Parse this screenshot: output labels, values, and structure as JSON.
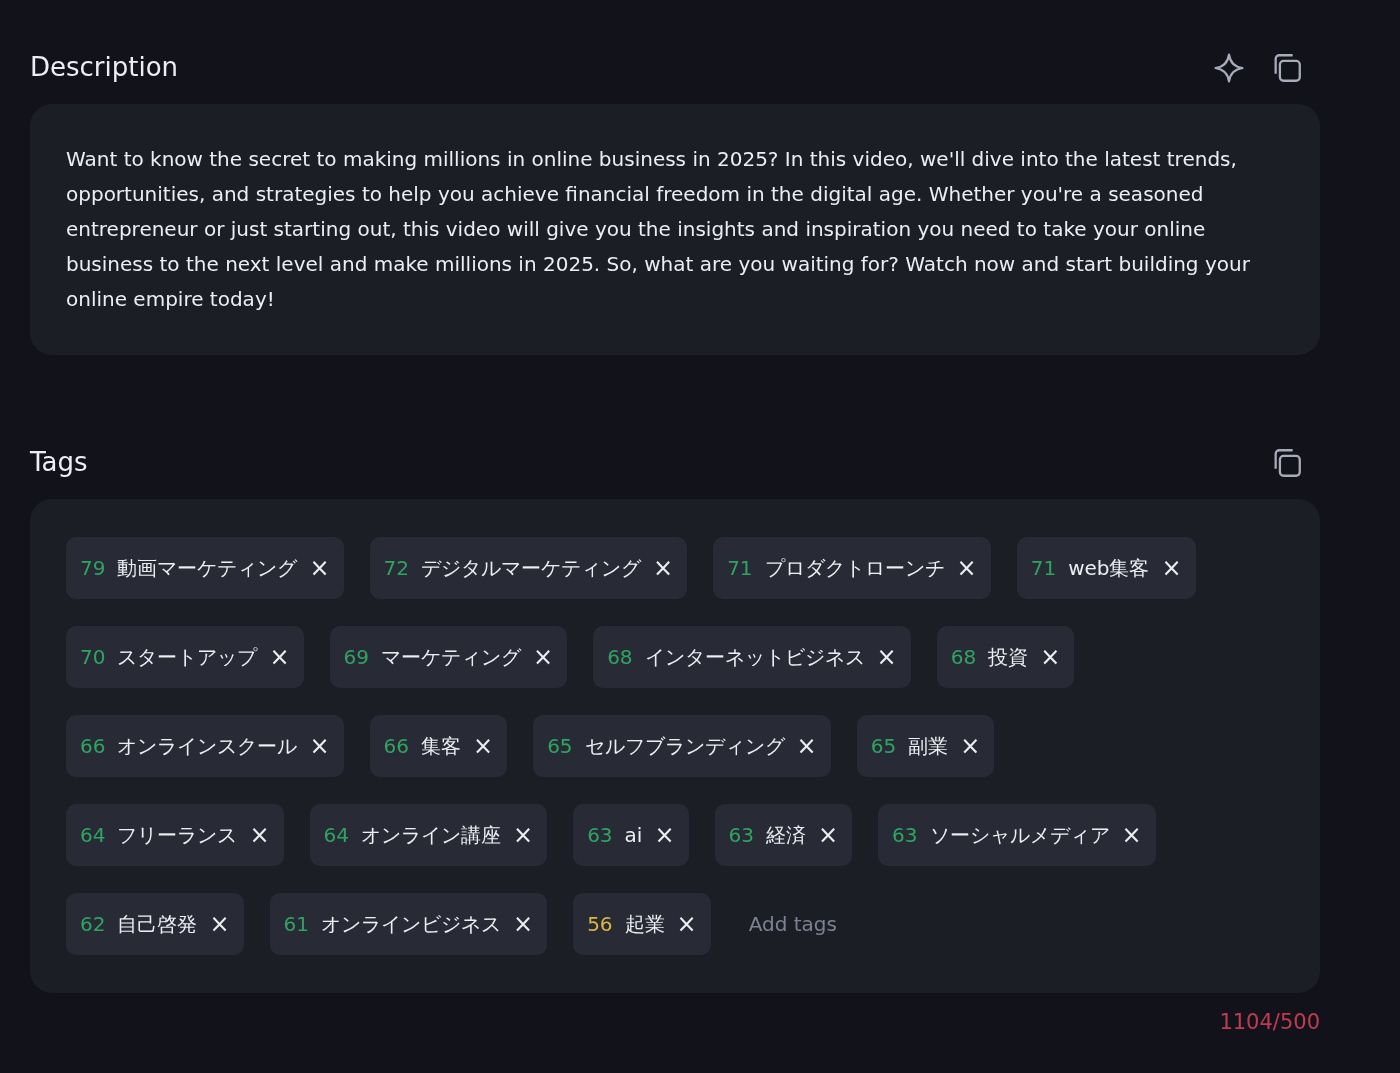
{
  "description": {
    "title": "Description",
    "text": "Want to know the secret to making millions in online business in 2025? In this video, we'll dive into the latest trends, opportunities, and strategies to help you achieve financial freedom in the digital age. Whether you're a seasoned entrepreneur or just starting out, this video will give you the insights and inspiration you need to take your online business to the next level and make millions in 2025. So, what are you waiting for? Watch now and start building your online empire today!"
  },
  "tags": {
    "title": "Tags",
    "items": [
      {
        "score": "79",
        "label": "動画マーケティング",
        "color": "#2ea55f"
      },
      {
        "score": "72",
        "label": "デジタルマーケティング",
        "color": "#2ea55f"
      },
      {
        "score": "71",
        "label": "プロダクトローンチ",
        "color": "#2ea55f"
      },
      {
        "score": "71",
        "label": "web集客",
        "color": "#2ea55f"
      },
      {
        "score": "70",
        "label": "スタートアップ",
        "color": "#2ea55f"
      },
      {
        "score": "69",
        "label": "マーケティング",
        "color": "#2ea55f"
      },
      {
        "score": "68",
        "label": "インターネットビジネス",
        "color": "#2ea55f"
      },
      {
        "score": "68",
        "label": "投資",
        "color": "#2ea55f"
      },
      {
        "score": "66",
        "label": "オンラインスクール",
        "color": "#2ea55f"
      },
      {
        "score": "66",
        "label": "集客",
        "color": "#2ea55f"
      },
      {
        "score": "65",
        "label": "セルフブランディング",
        "color": "#2ea55f"
      },
      {
        "score": "65",
        "label": "副業",
        "color": "#2ea55f"
      },
      {
        "score": "64",
        "label": "フリーランス",
        "color": "#2ea55f"
      },
      {
        "score": "64",
        "label": "オンライン講座",
        "color": "#2ea55f"
      },
      {
        "score": "63",
        "label": "ai",
        "color": "#2ea55f"
      },
      {
        "score": "63",
        "label": "経済",
        "color": "#2ea55f"
      },
      {
        "score": "63",
        "label": "ソーシャルメディア",
        "color": "#2ea55f"
      },
      {
        "score": "62",
        "label": "自己啓発",
        "color": "#2ea55f"
      },
      {
        "score": "61",
        "label": "オンラインビジネス",
        "color": "#2ea55f"
      },
      {
        "score": "56",
        "label": "起業",
        "color": "#d9b63c"
      }
    ],
    "remove_symbol": "×",
    "input": {
      "placeholder": "Add tags"
    },
    "counter": "1104/500"
  }
}
